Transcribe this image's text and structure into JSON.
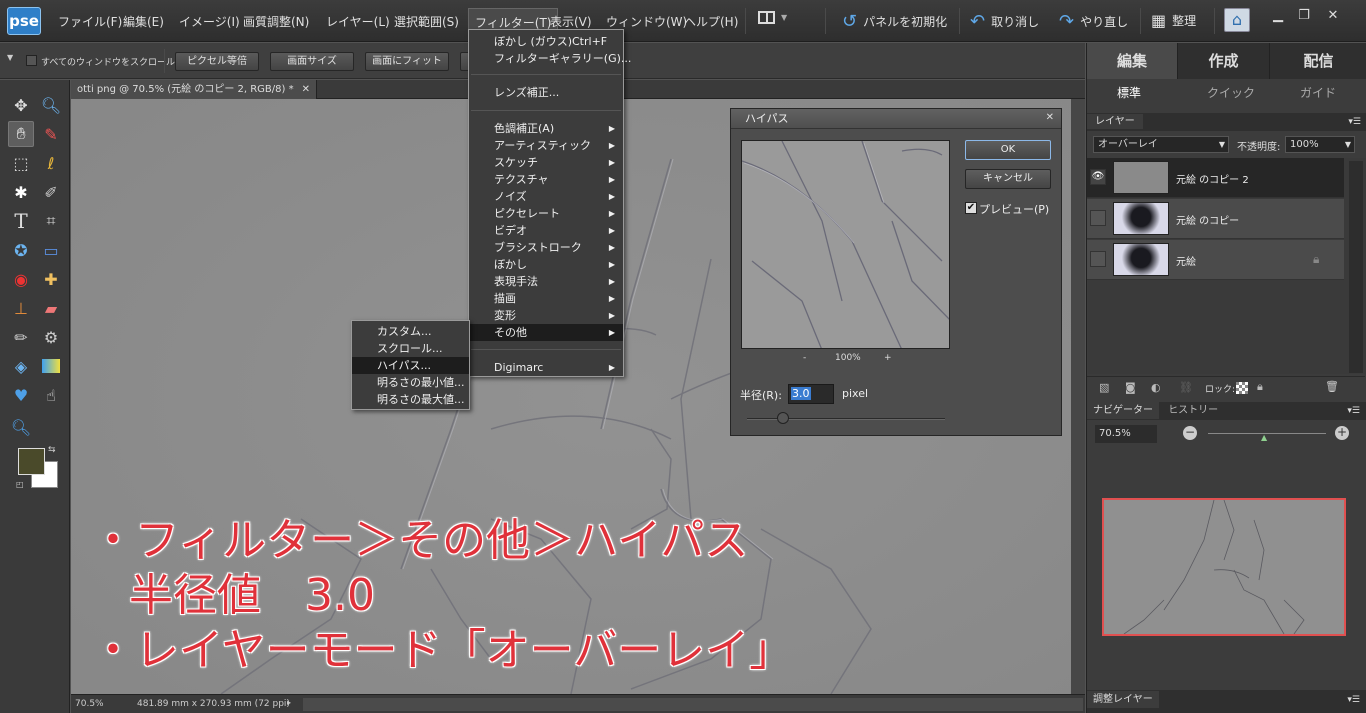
{
  "app": {
    "logo": "pse"
  },
  "menubar": {
    "items": [
      "ファイル(F)",
      "編集(E)",
      "イメージ(I)",
      "画質調整(N)",
      "レイヤー(L)",
      "選択範囲(S)",
      "フィルター(T)",
      "表示(V)",
      "ウィンドウ(W)",
      "ヘルプ(H)"
    ],
    "reset_panels": "パネルを初期化",
    "undo": "取り消し",
    "redo": "やり直し",
    "organize": "整理"
  },
  "options": {
    "scroll_all": "すべてのウィンドウをスクロール",
    "actual_pixels": "ピクセル等倍",
    "fit_screen": "画面サイズ",
    "fill_screen": "画面にフィット"
  },
  "document": {
    "tab_title": "otti png @ 70.5% (元絵 のコピー 2, RGB/8) *",
    "zoom": "70.5%",
    "doc_size": "481.89 mm x 270.93 mm (72 ppi)"
  },
  "filter_menu": {
    "top": [
      {
        "label": "ぼかし (ガウス)",
        "shortcut": "Ctrl+F"
      },
      {
        "label": "フィルターギャラリー(G)..."
      }
    ],
    "lens": "レンズ補正...",
    "groups": [
      "色調補正(A)",
      "アーティスティック",
      "スケッチ",
      "テクスチャ",
      "ノイズ",
      "ピクセレート",
      "ビデオ",
      "ブラシストローク",
      "ぼかし",
      "表現手法",
      "描画",
      "変形",
      "その他"
    ],
    "digimarc": "Digimarc"
  },
  "other_submenu": {
    "items": [
      "カスタム...",
      "スクロール...",
      "ハイパス...",
      "明るさの最小値...",
      "明るさの最大値..."
    ]
  },
  "highpass_dialog": {
    "title": "ハイパス",
    "ok": "OK",
    "cancel": "キャンセル",
    "preview": "プレビュー(P)",
    "preview_checked": true,
    "zoom": "100%",
    "minus": "-",
    "plus": "+",
    "radius_label": "半径(R):",
    "radius_value": "3.0",
    "unit": "pixel",
    "radius_slider": 0.03
  },
  "right_panel": {
    "tabs": [
      "編集",
      "作成",
      "配信"
    ],
    "subtabs": [
      "標準",
      "クイック",
      "ガイド"
    ],
    "layers_tab": "レイヤー",
    "blend_mode": "オーバーレイ",
    "opacity_label": "不透明度:",
    "opacity_value": "100%",
    "layers": [
      {
        "name": "元絵 のコピー 2",
        "visible": true
      },
      {
        "name": "元絵 のコピー",
        "visible": false
      },
      {
        "name": "元絵",
        "visible": false,
        "locked": true
      }
    ],
    "lock_label": "ロック:",
    "navigator_tab": "ナビゲーター",
    "history_tab": "ヒストリー",
    "nav_zoom": "70.5%",
    "nav_zoom_level": 0.28,
    "adjust_layer": "調整レイヤー"
  },
  "overlay_text": {
    "line1": "・フィルター＞その他＞ハイパス",
    "line2": "半径値　3.0",
    "line3": "・レイヤーモード「オーバーレイ」"
  },
  "colors": {
    "overlay_red": "#e0313a",
    "foreground": "#4a4a2a",
    "background": "#ffffff",
    "accent": "#2f7fc8"
  }
}
